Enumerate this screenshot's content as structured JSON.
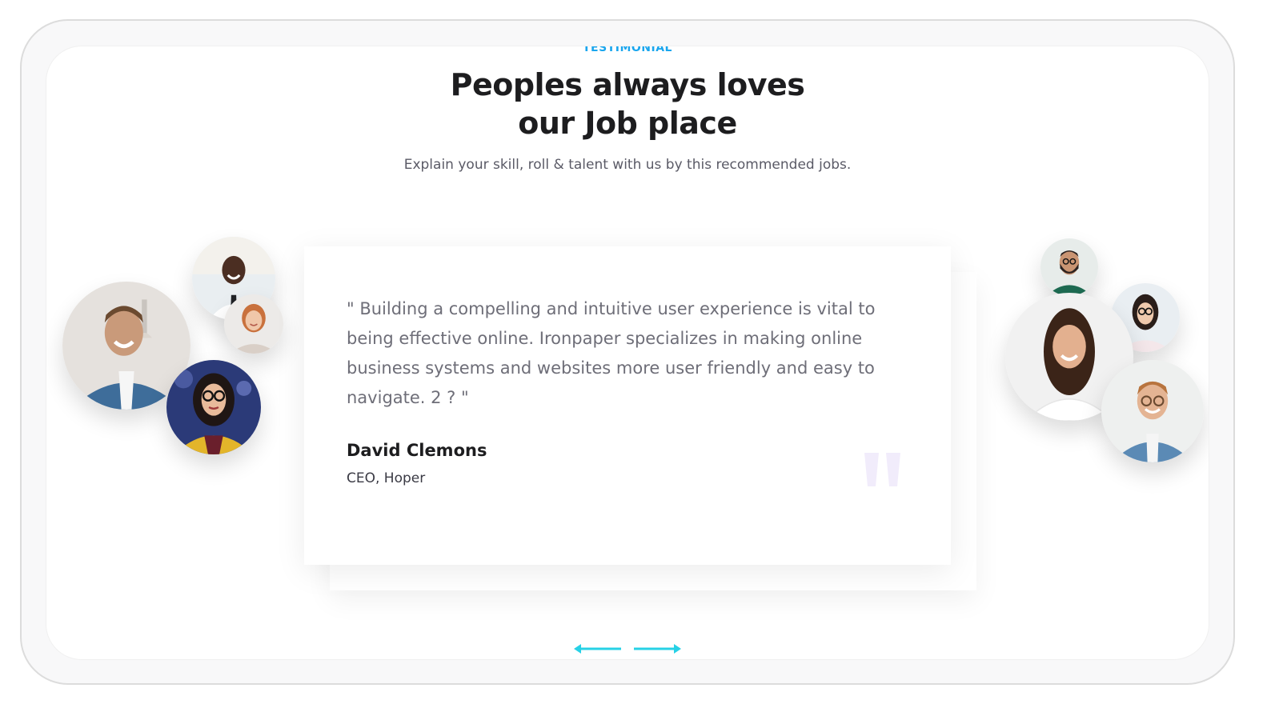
{
  "section": {
    "eyebrow": "TESTIMONIAL",
    "title_line1": "Peoples always loves",
    "title_line2": "our Job place",
    "subtitle": "Explain your skill, roll & talent with us by this recommended jobs."
  },
  "testimonial": {
    "quote": "\" Building a compelling and intuitive user experience is vital to being effective online. Ironpaper specializes in making online business systems and websites more user friendly and easy to navigate. 2 ? \"",
    "author": "David Clemons",
    "role": "CEO, Hoper"
  },
  "colors": {
    "accent": "#1aa6ee",
    "arrow": "#27d1e6",
    "quote_mark": "#f1ecfb"
  },
  "icons": {
    "prev": "arrow-left-icon",
    "next": "arrow-right-icon",
    "quote": "quote-mark-icon"
  }
}
